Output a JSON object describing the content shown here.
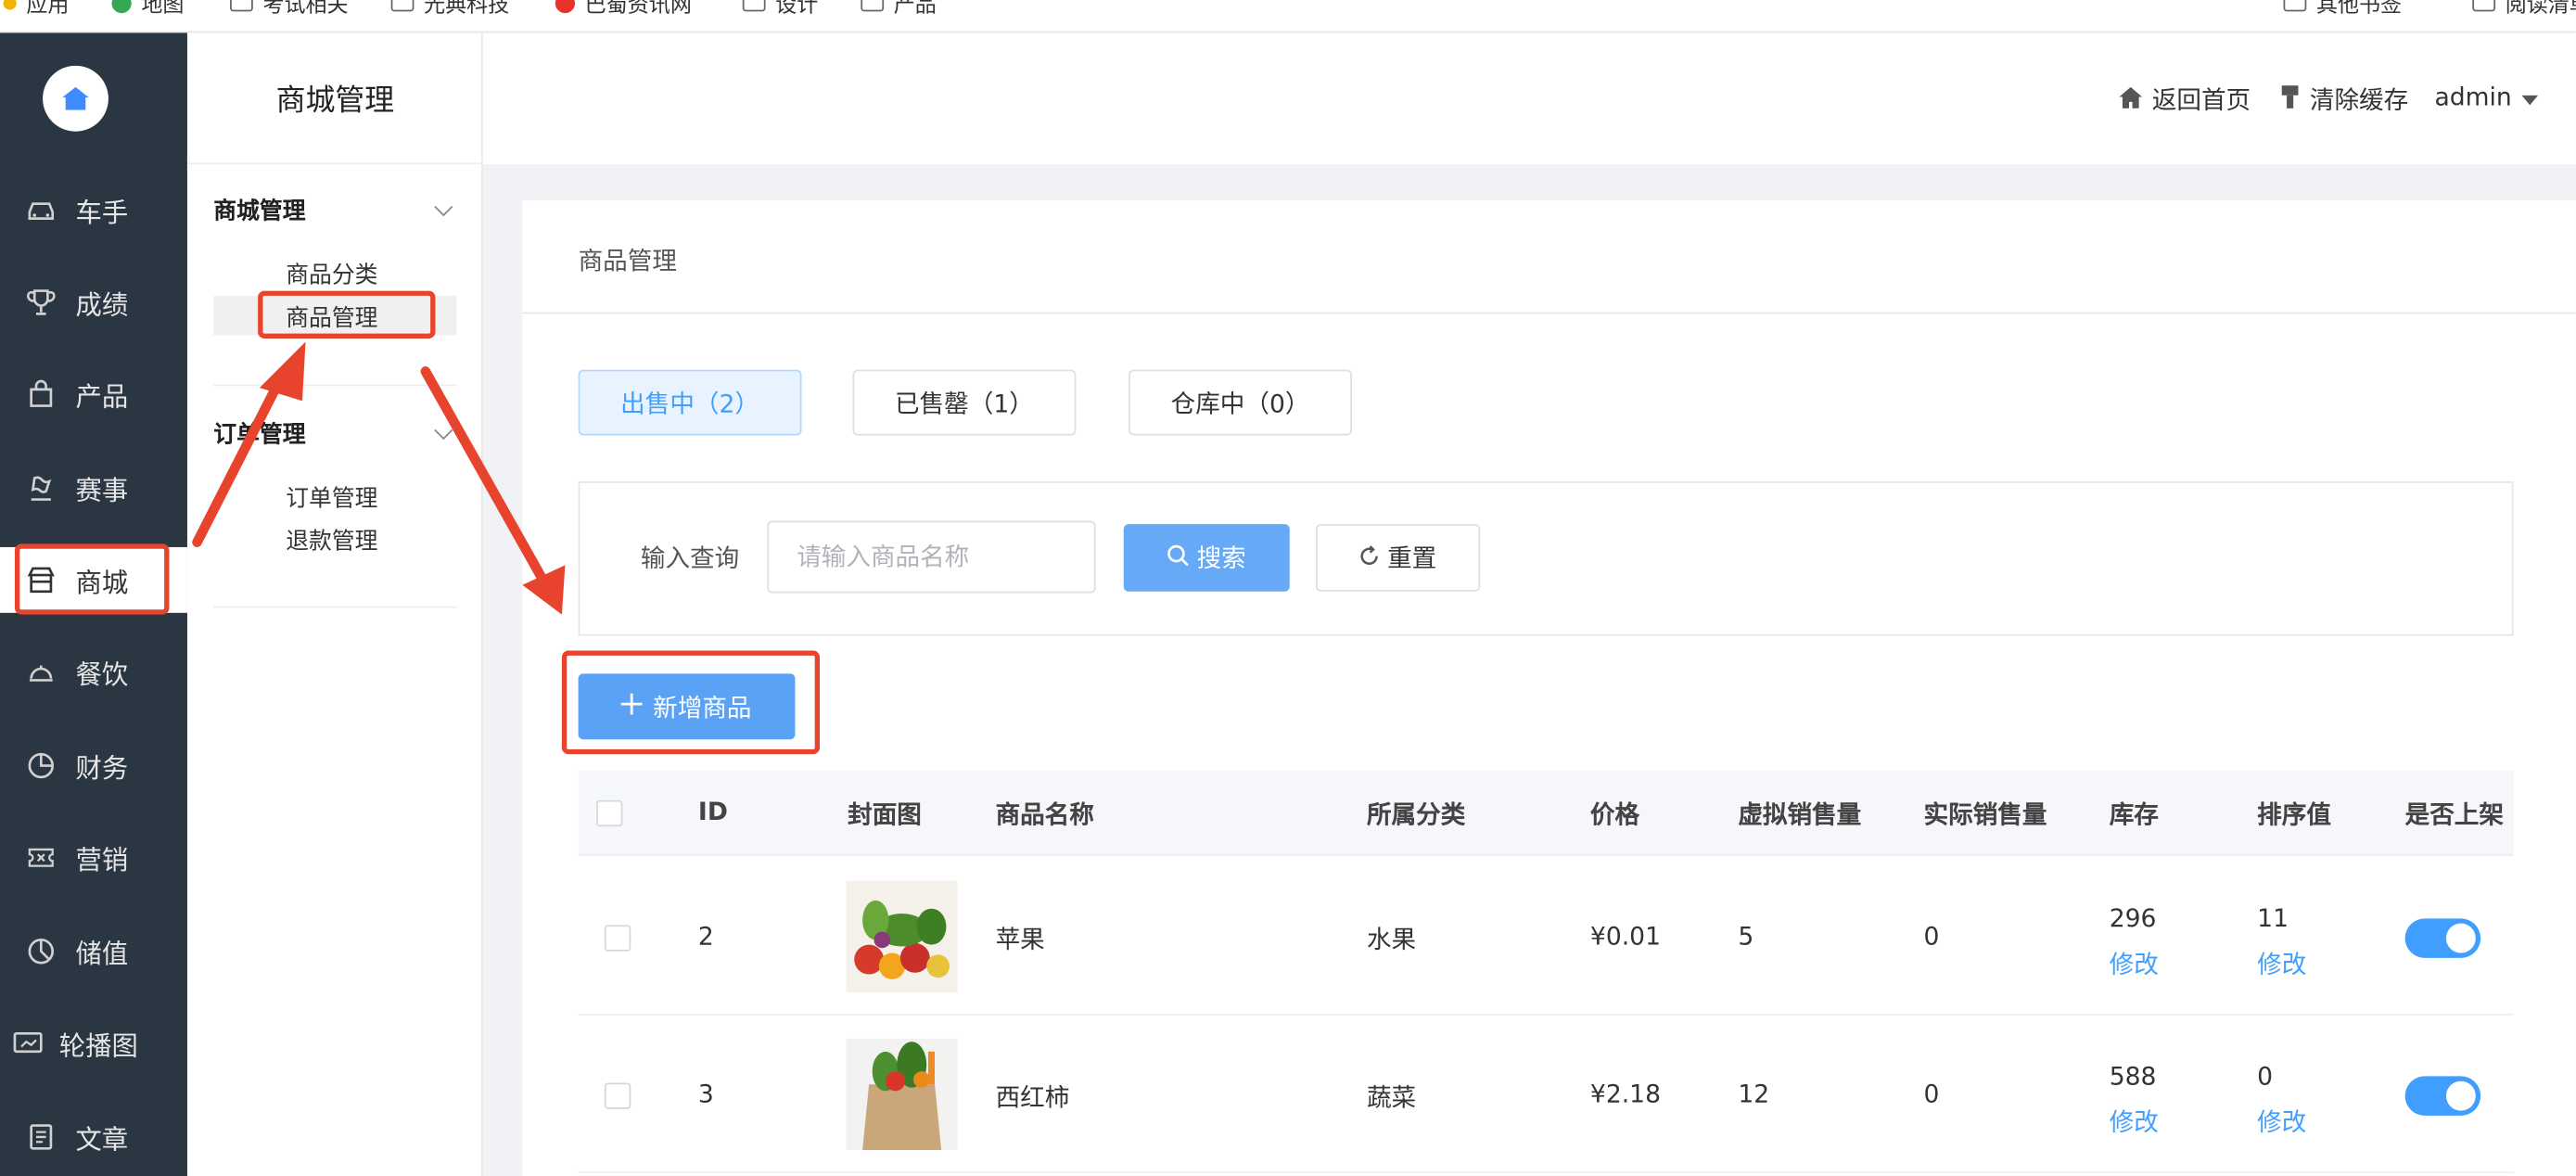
{
  "bookmarks": [
    "应用",
    "地图",
    "考试相关",
    "光典科技",
    "巴蜀资讯网",
    "设计",
    "产品",
    "其他书签",
    "阅读清单"
  ],
  "sidebar": {
    "items": [
      {
        "label": "车手",
        "icon": "car-icon"
      },
      {
        "label": "成绩",
        "icon": "trophy-icon"
      },
      {
        "label": "产品",
        "icon": "bag-icon"
      },
      {
        "label": "赛事",
        "icon": "flag-icon"
      },
      {
        "label": "商城",
        "icon": "store-icon",
        "active": true
      },
      {
        "label": "餐饮",
        "icon": "dish-icon"
      },
      {
        "label": "财务",
        "icon": "pie-icon"
      },
      {
        "label": "营销",
        "icon": "ticket-icon"
      },
      {
        "label": "储值",
        "icon": "wallet-icon"
      },
      {
        "label": "轮播图",
        "icon": "carousel-icon"
      },
      {
        "label": "文章",
        "icon": "article-icon"
      }
    ]
  },
  "submenu": {
    "title": "商城管理",
    "groups": [
      {
        "label": "商城管理",
        "items": [
          "商品分类",
          "商品管理"
        ]
      },
      {
        "label": "订单管理",
        "items": [
          "订单管理",
          "退款管理"
        ]
      }
    ]
  },
  "header": {
    "home_label": "返回首页",
    "clear_cache_label": "清除缓存",
    "user": "admin"
  },
  "card": {
    "title": "商品管理",
    "tabs": [
      "出售中（2）",
      "已售罄（1）",
      "仓库中（0）"
    ],
    "search_label": "输入查询",
    "search_placeholder": "请输入商品名称",
    "search_button": "搜索",
    "reset_button": "重置",
    "add_button": "新增商品"
  },
  "table": {
    "columns": [
      "ID",
      "封面图",
      "商品名称",
      "所属分类",
      "价格",
      "虚拟销售量",
      "实际销售量",
      "库存",
      "排序值",
      "是否上架"
    ],
    "rows": [
      {
        "id": "2",
        "name": "苹果",
        "category": "水果",
        "price": "¥0.01",
        "virtual_sales": "5",
        "actual_sales": "0",
        "stock": "296",
        "sort": "11",
        "edit": "修改",
        "on_shelf": true
      },
      {
        "id": "3",
        "name": "西红柿",
        "category": "蔬菜",
        "price": "¥2.18",
        "virtual_sales": "12",
        "actual_sales": "0",
        "stock": "588",
        "sort": "0",
        "edit": "修改",
        "on_shelf": true
      }
    ]
  },
  "colors": {
    "accent": "#409eff",
    "sidebar_bg": "#2b3643",
    "annotation_red": "#e8432d"
  }
}
